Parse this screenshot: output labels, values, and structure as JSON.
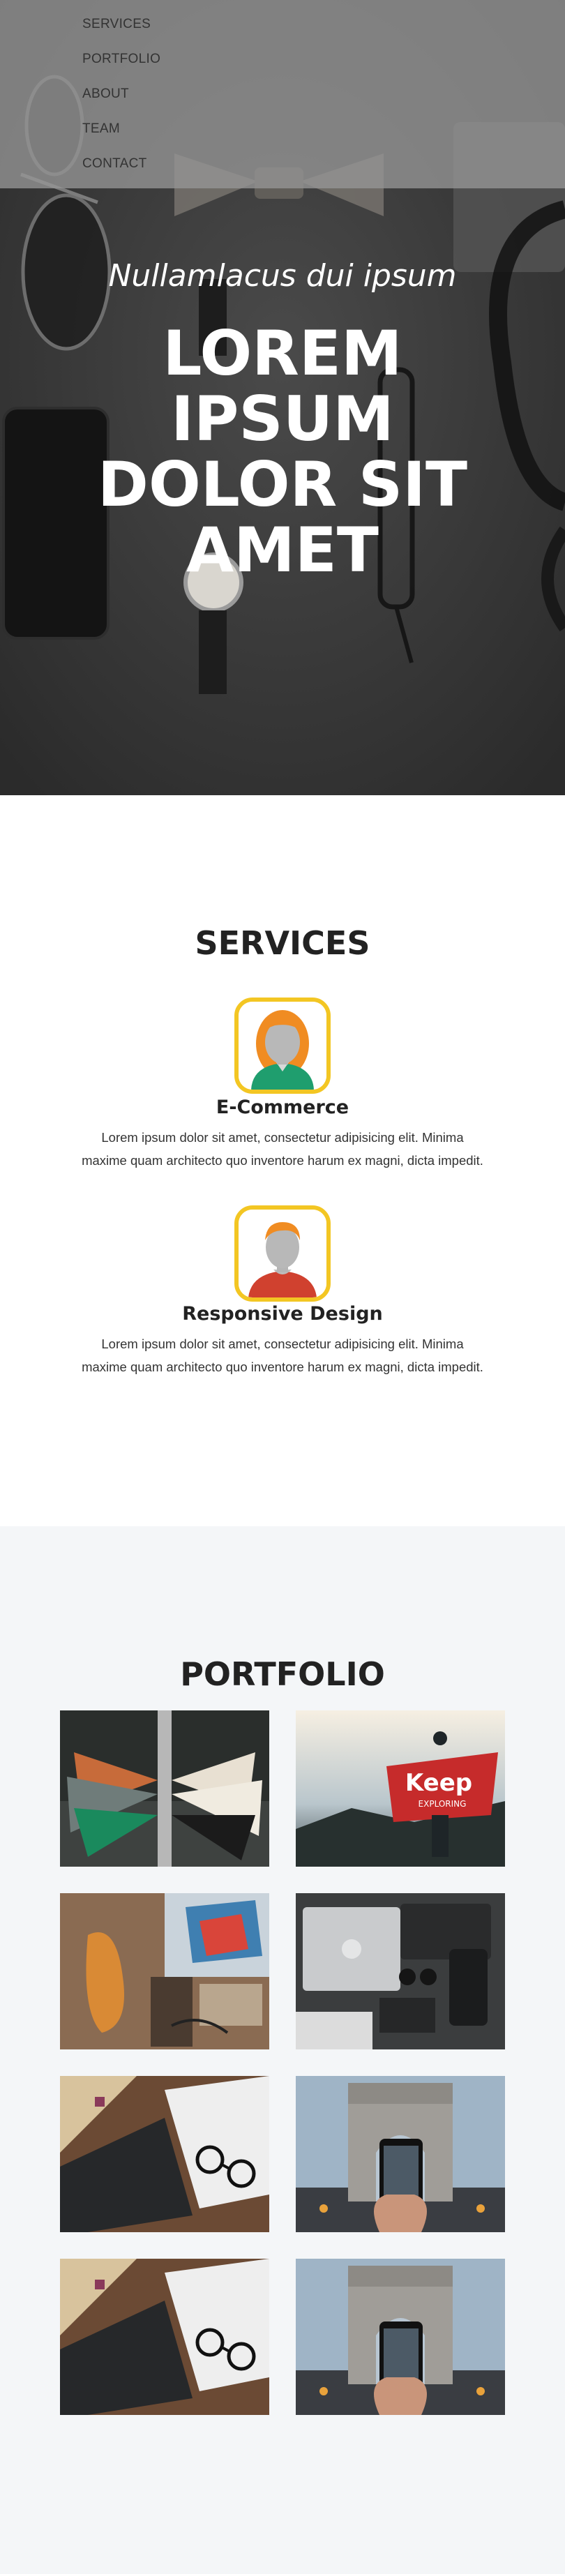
{
  "nav": {
    "items": [
      "SERVICES",
      "PORTFOLIO",
      "ABOUT",
      "TEAM",
      "CONTACT"
    ]
  },
  "hero": {
    "subtitle": "Nullamlacus dui ipsum",
    "title_lines": [
      "LOREM",
      "IPSUM",
      "DOLOR SIT",
      "AMET"
    ]
  },
  "services": {
    "title": "SERVICES",
    "items": [
      {
        "name": "E-Commerce",
        "icon": "female-avatar-icon",
        "desc_line1": "Lorem ipsum dolor sit amet, consectetur adipisicing elit. Minima",
        "desc_line2": "maxime quam architecto quo inventore harum ex magni, dicta impedit."
      },
      {
        "name": "Responsive Design",
        "icon": "male-avatar-icon",
        "desc_line1": "Lorem ipsum dolor sit amet, consectetur adipisicing elit. Minima",
        "desc_line2": "maxime quam architecto quo inventore harum ex magni, dicta impedit."
      }
    ]
  },
  "portfolio": {
    "title": "PORTFOLIO",
    "images": [
      "clothes-rack-image",
      "keep-exploring-flag-image",
      "desk-guitar-image",
      "laptop-camera-flatlay-image",
      "laptop-glasses-desk-image",
      "arc-de-triomphe-phone-image",
      "laptop-glasses-desk-image",
      "arc-de-triomphe-phone-image"
    ],
    "flag_text": [
      "Keep",
      "EXPLORING"
    ]
  },
  "colors": {
    "accent_yellow": "#f3c623",
    "nav_overlay": "#969696",
    "hero_dark": "#3a3a3a",
    "portfolio_bg": "#f4f6f8"
  }
}
